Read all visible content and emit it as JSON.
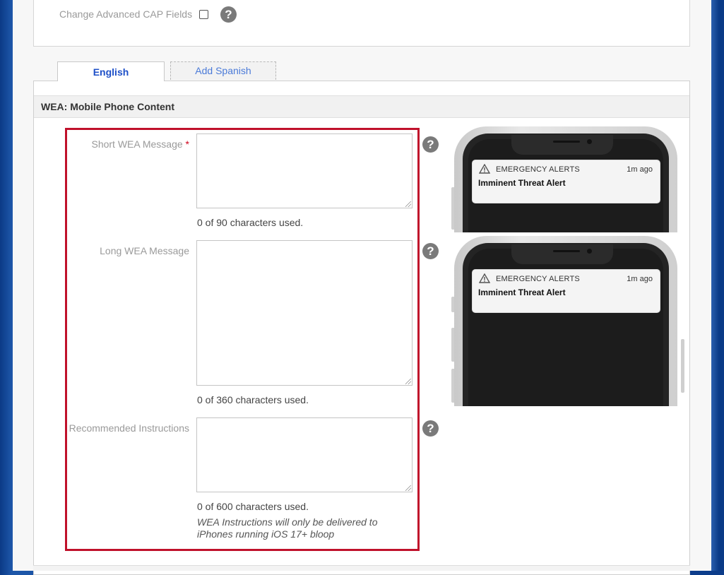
{
  "advanced_cap": {
    "label": "Change Advanced CAP Fields",
    "checked": false
  },
  "tabs": [
    {
      "label": "English",
      "active": true
    },
    {
      "label": "Add Spanish",
      "active": false
    }
  ],
  "section": {
    "title": "WEA: Mobile Phone Content"
  },
  "fields": {
    "short": {
      "label": "Short WEA Message",
      "required_mark": "*",
      "value": "",
      "count": "0 of 90 characters used."
    },
    "long": {
      "label": "Long WEA Message",
      "value": "",
      "count": "0 of 360 characters used."
    },
    "instructions": {
      "label": "Recommended Instructions",
      "value": "",
      "count": "0 of 600 characters used.",
      "note": "WEA Instructions will only be delivered to iPhones running iOS 17+ bloop"
    }
  },
  "previews": [
    {
      "app": "EMERGENCY ALERTS",
      "time": "1m ago",
      "title": "Imminent Threat Alert"
    },
    {
      "app": "EMERGENCY ALERTS",
      "time": "1m ago",
      "title": "Imminent Threat Alert"
    }
  ],
  "help_glyph": "?",
  "colors": {
    "accent_tab": "#1e50c8",
    "highlight_border": "#c0112b",
    "required": "#d0021b"
  },
  "icons": {
    "help": "question-circle-icon",
    "warning": "warning-triangle-icon"
  }
}
